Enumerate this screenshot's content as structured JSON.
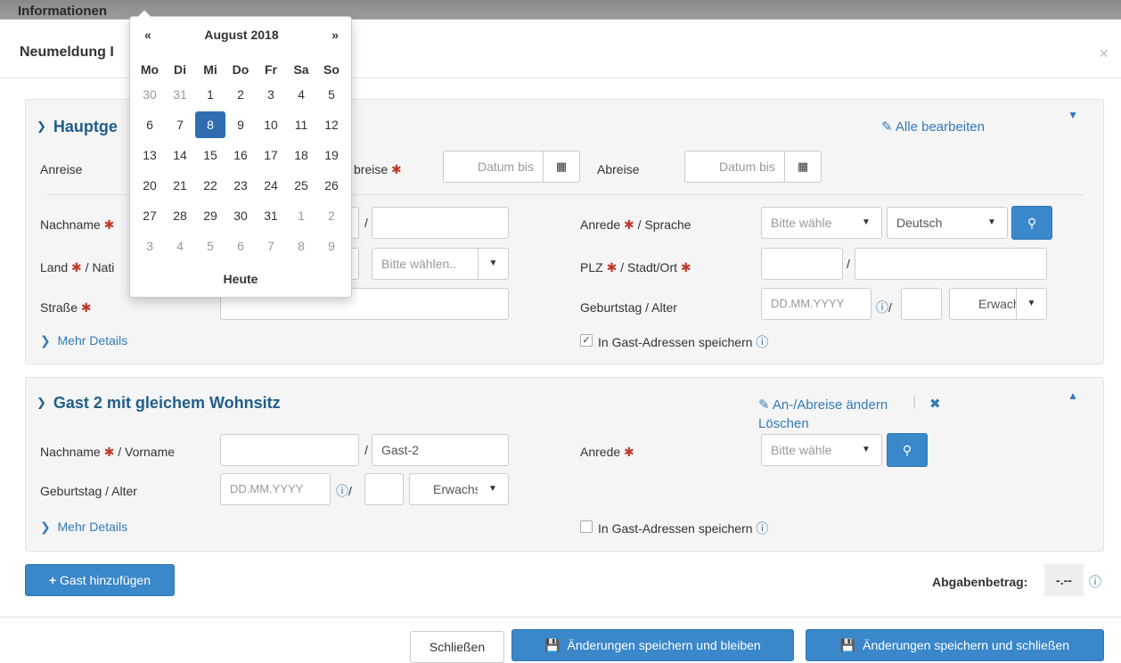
{
  "background_window": {
    "title_fragment": "Informationen"
  },
  "modal": {
    "title": "Neumeldung I",
    "close": "×"
  },
  "panel1": {
    "title": "Hauptge",
    "edit_all": "Alle bearbeiten",
    "anreise_label": "Anreise",
    "abreise_req_label": "breise",
    "datum_bis_placeholder": "Datum bis",
    "abreise_label": "Abreise",
    "datum_bis_placeholder2": "Datum bis",
    "nachname_label": "Nachname",
    "land_label": "Land",
    "land_label_suffix": "/ Nati",
    "nation_select": "Bitte wählen..",
    "strasse_label": "Straße",
    "mehr_details": "Mehr Details",
    "anrede_label": "Anrede",
    "sprache_suffix": "/ Sprache",
    "anrede_select": "Bitte wähle",
    "sprache_select": "Deutsch",
    "plz_label": "PLZ",
    "stadt_label": "/ Stadt/Ort",
    "geburtstag_label": "Geburtstag / Alter",
    "geburtstag_placeholder": "DD.MM.YYYY",
    "alter_select": "Erwachs",
    "save_address": "In Gast-Adressen speichern",
    "save_address_checked": true
  },
  "panel2": {
    "title": "Gast 2 mit gleichem Wohnsitz",
    "change_dates": "An-/Abreise ändern",
    "delete": "Löschen",
    "nachname_label": "Nachname",
    "vorname_suffix": "/ Vorname",
    "vorname_value": "Gast-2",
    "anrede_label": "Anrede",
    "anrede_select": "Bitte wähle",
    "geburtstag_label": "Geburtstag / Alter",
    "geburtstag_placeholder": "DD.MM.YYYY",
    "alter_select": "Erwachs",
    "mehr_details": "Mehr Details",
    "save_address": "In Gast-Adressen speichern",
    "save_address_checked": false
  },
  "add_guest": "Gast hinzufügen",
  "abgabe": {
    "label": "Abgabenbetrag:",
    "value": "-.--"
  },
  "footer": {
    "close": "Schließen",
    "save_stay": "Änderungen speichern und bleiben",
    "save_close": "Änderungen speichern und schließen"
  },
  "datepicker": {
    "prev": "«",
    "next": "»",
    "month": "August 2018",
    "weekdays": [
      "Mo",
      "Di",
      "Mi",
      "Do",
      "Fr",
      "Sa",
      "So"
    ],
    "weeks": [
      [
        "30",
        "31",
        "1",
        "2",
        "3",
        "4",
        "5"
      ],
      [
        "6",
        "7",
        "8",
        "9",
        "10",
        "11",
        "12"
      ],
      [
        "13",
        "14",
        "15",
        "16",
        "17",
        "18",
        "19"
      ],
      [
        "20",
        "21",
        "22",
        "23",
        "24",
        "25",
        "26"
      ],
      [
        "27",
        "28",
        "29",
        "30",
        "31",
        "1",
        "2"
      ],
      [
        "3",
        "4",
        "5",
        "6",
        "7",
        "8",
        "9"
      ]
    ],
    "selected_day": "8",
    "today": "Heute"
  },
  "colors": {
    "primary": "#3a87c9",
    "title_blue": "#1f5e8c",
    "required": "#c0392b"
  }
}
